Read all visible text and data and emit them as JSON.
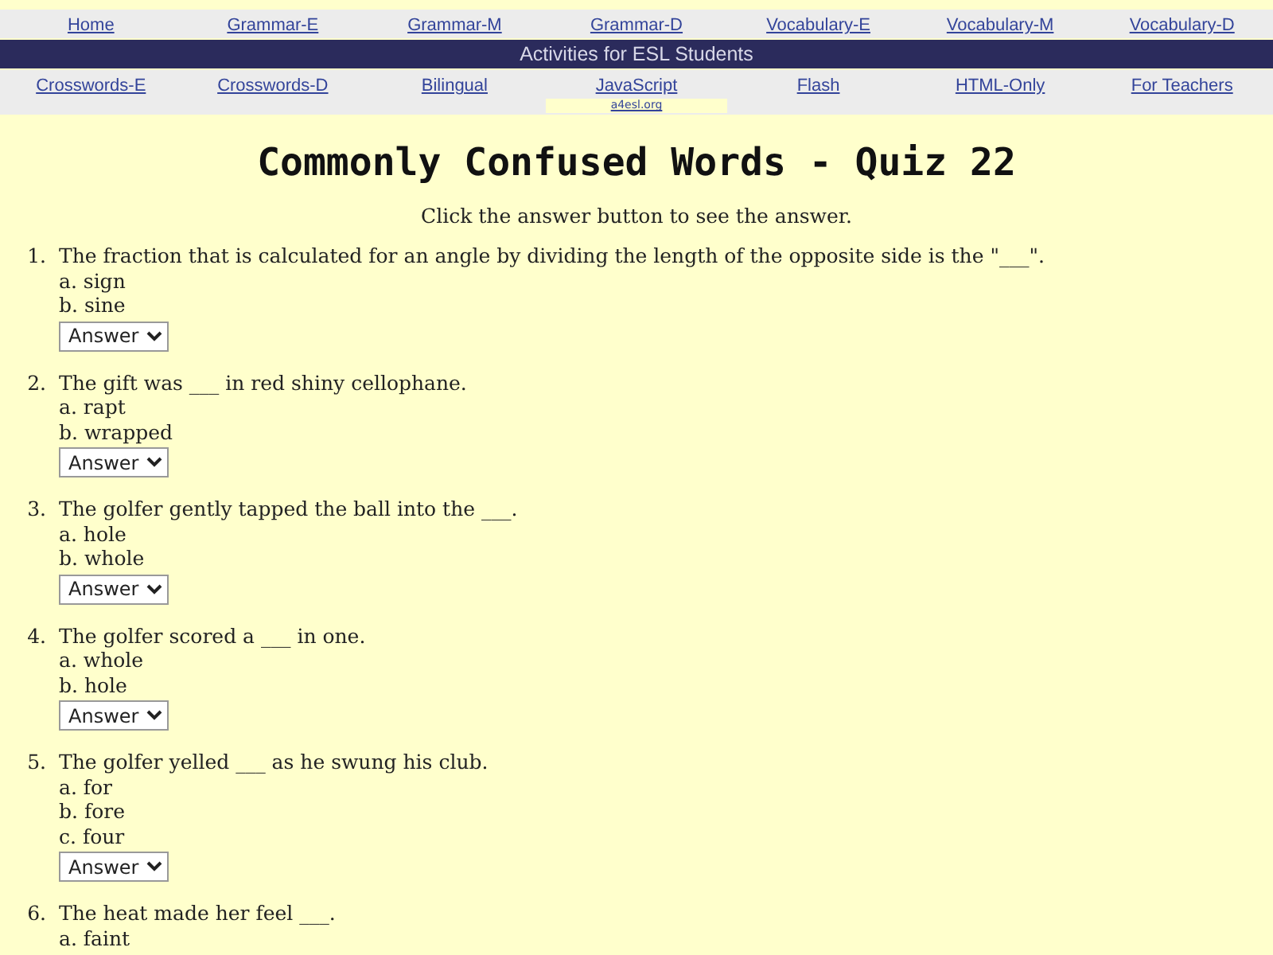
{
  "nav_top": [
    {
      "label": "Home"
    },
    {
      "label": "Grammar-E"
    },
    {
      "label": "Grammar-M"
    },
    {
      "label": "Grammar-D"
    },
    {
      "label": "Vocabulary-E"
    },
    {
      "label": "Vocabulary-M"
    },
    {
      "label": "Vocabulary-D"
    }
  ],
  "banner": "Activities for ESL Students",
  "nav_bottom": [
    {
      "label": "Crosswords-E"
    },
    {
      "label": "Crosswords-D"
    },
    {
      "label": "Bilingual"
    },
    {
      "label": "JavaScript",
      "sub": "a4esl.org"
    },
    {
      "label": "Flash"
    },
    {
      "label": "HTML-Only"
    },
    {
      "label": "For Teachers"
    }
  ],
  "title": "Commonly Confused Words - Quiz 22",
  "instructions": "Click the answer button to see the answer.",
  "questions": [
    {
      "number": "1.",
      "text": "The fraction that is calculated for an angle by dividing the length of the opposite side is the \"___\".",
      "options": [
        "a. sign",
        "b. sine"
      ],
      "answer_button": "Answer"
    },
    {
      "number": "2.",
      "text": "The gift was ___ in red shiny cellophane.",
      "options": [
        "a. rapt",
        "b. wrapped"
      ],
      "answer_button": "Answer"
    },
    {
      "number": "3.",
      "text": "The golfer gently tapped the ball into the ___.",
      "options": [
        "a. hole",
        "b. whole"
      ],
      "answer_button": "Answer"
    },
    {
      "number": "4.",
      "text": "The golfer scored a ___ in one.",
      "options": [
        "a. whole",
        "b. hole"
      ],
      "answer_button": "Answer"
    },
    {
      "number": "5.",
      "text": "The golfer yelled ___ as he swung his club.",
      "options": [
        "a. for",
        "b. fore",
        "c. four"
      ],
      "answer_button": "Answer"
    },
    {
      "number": "6.",
      "text": "The heat made her feel ___.",
      "options": [
        "a. faint"
      ]
    }
  ]
}
